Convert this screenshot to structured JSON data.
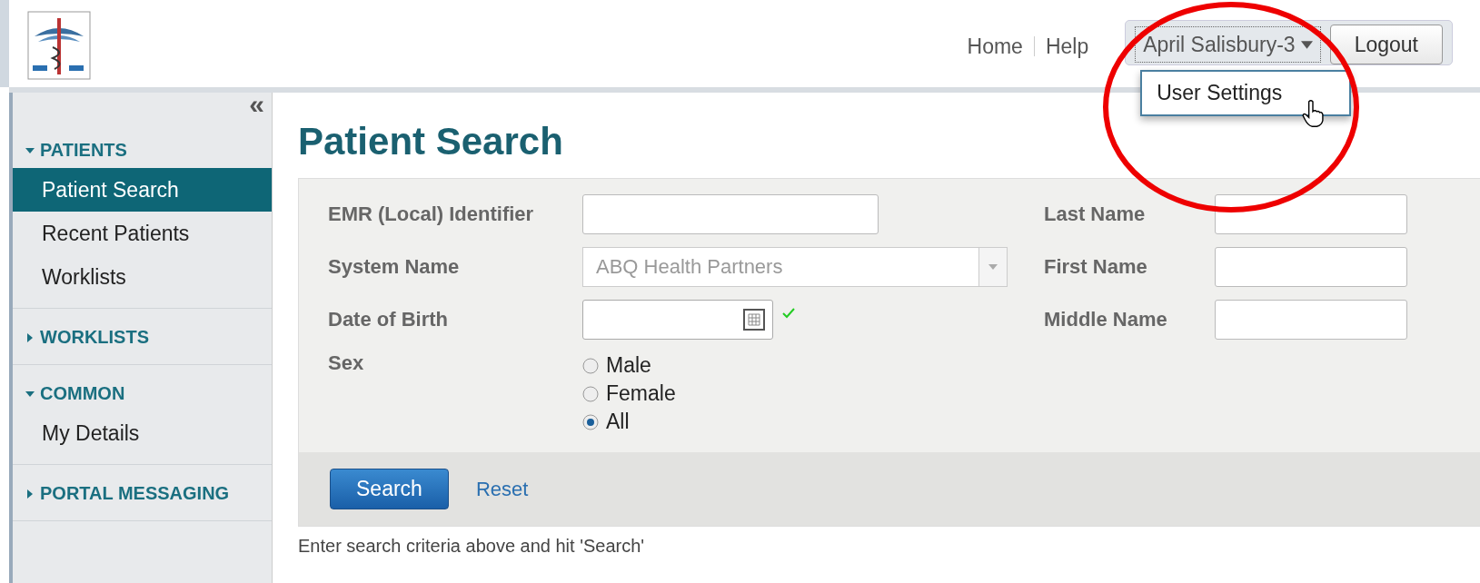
{
  "header": {
    "nav": [
      "Home",
      "Help"
    ],
    "user": {
      "name": "April Salisbury-3",
      "menu": [
        "User Settings"
      ]
    },
    "logout": "Logout"
  },
  "sidebar": {
    "collapse": "«",
    "sections": [
      {
        "title": "PATIENTS",
        "expanded": true,
        "items": [
          {
            "label": "Patient Search",
            "selected": true
          },
          {
            "label": "Recent Patients",
            "selected": false
          },
          {
            "label": "Worklists",
            "selected": false
          }
        ]
      },
      {
        "title": "WORKLISTS",
        "expanded": false
      },
      {
        "title": "COMMON",
        "expanded": true,
        "items": [
          {
            "label": "My Details",
            "selected": false
          }
        ]
      },
      {
        "title": "PORTAL MESSAGING",
        "expanded": false
      }
    ]
  },
  "page_title": "Patient Search",
  "form": {
    "left": [
      {
        "label": "EMR (Local) Identifier",
        "kind": "text"
      },
      {
        "label": "System Name",
        "kind": "select",
        "value": "ABQ Health Partners"
      },
      {
        "label": "Date of Birth",
        "kind": "date",
        "valid": true
      }
    ],
    "right": [
      {
        "label": "Last Name"
      },
      {
        "label": "First Name"
      },
      {
        "label": "Middle Name"
      }
    ],
    "sex": {
      "label": "Sex",
      "options": [
        {
          "label": "Male",
          "selected": false
        },
        {
          "label": "Female",
          "selected": false
        },
        {
          "label": "All",
          "selected": true
        }
      ]
    },
    "search": "Search",
    "reset": "Reset"
  },
  "hint": "Enter search criteria above and hit 'Search'"
}
